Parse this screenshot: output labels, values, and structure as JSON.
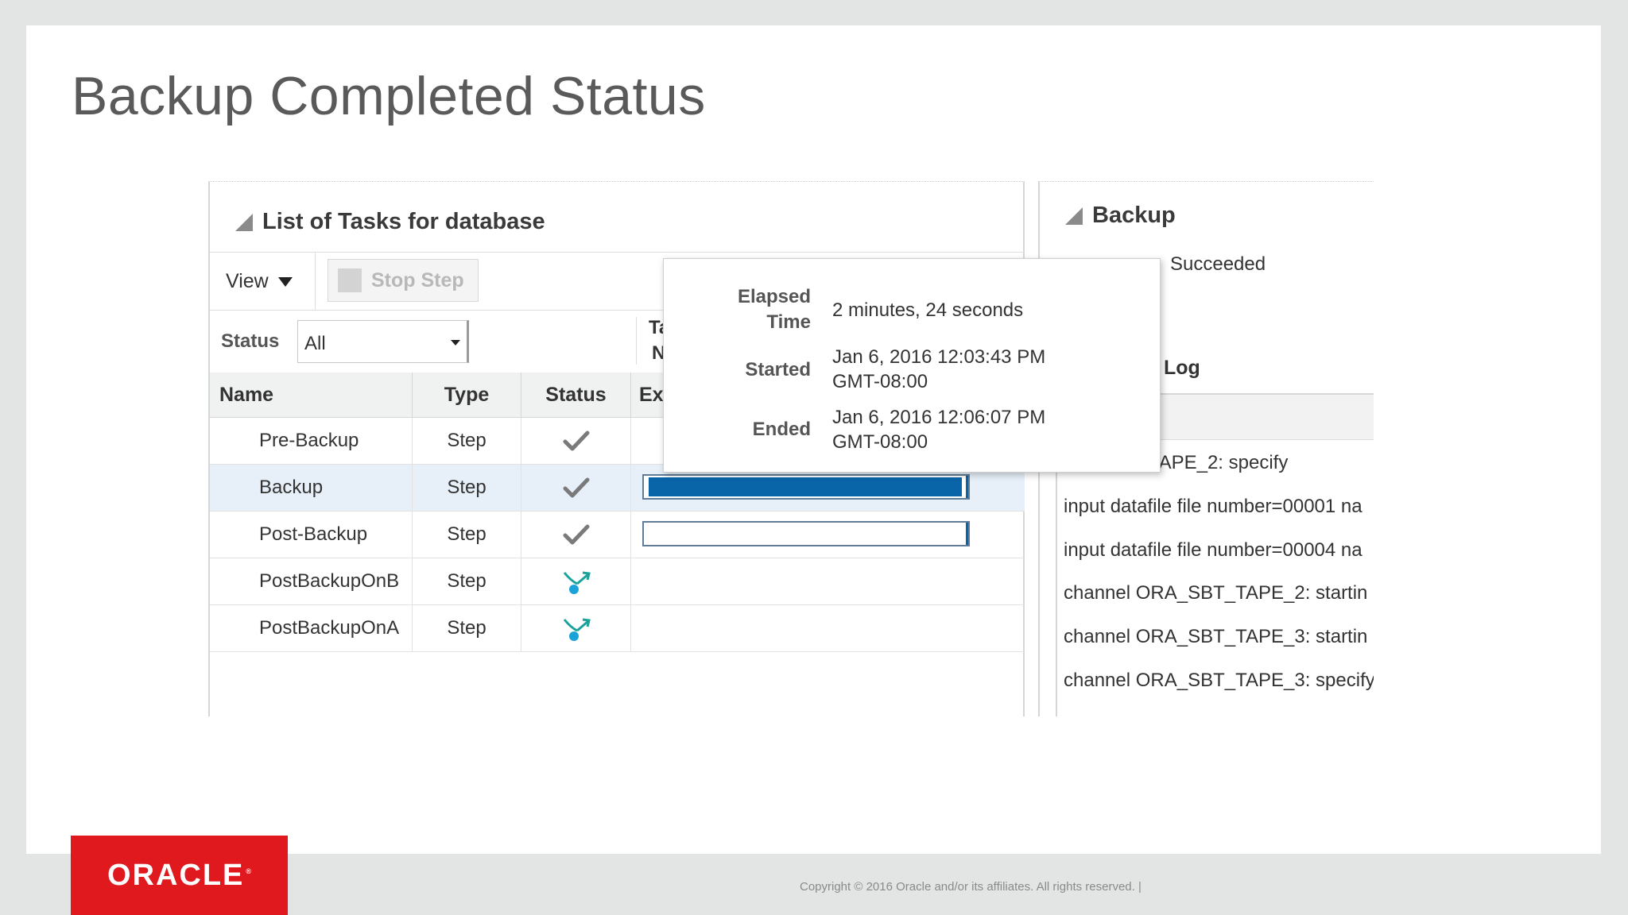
{
  "slide": {
    "title": "Backup Completed Status",
    "logo": "ORACLE",
    "copyright": "Copyright © 2016 Oracle and/or its affiliates. All rights reserved.  |"
  },
  "tasks": {
    "title": "List of Tasks for database",
    "view_label": "View",
    "stop_step_label": "Stop Step",
    "filter_label": "Status",
    "filter_value": "All",
    "trunc_col_line1": "Ta",
    "trunc_col_line2": "N",
    "columns": {
      "name": "Name",
      "type": "Type",
      "status": "Status",
      "exec": "Ex"
    },
    "rows": [
      {
        "name": "Pre-Backup",
        "type": "Step",
        "status": "check-icon"
      },
      {
        "name": "Backup",
        "type": "Step",
        "status": "check-icon",
        "progress": 1.0
      },
      {
        "name": "Post-Backup",
        "type": "Step",
        "status": "check-icon",
        "progress": 0.0
      },
      {
        "name": "PostBackupOnB",
        "type": "Step",
        "status": "skipped-icon"
      },
      {
        "name": "PostBackupOnA",
        "type": "Step",
        "status": "skipped-icon"
      }
    ]
  },
  "tooltip": {
    "elapsed_label_1": "Elapsed",
    "elapsed_label_2": "Time",
    "elapsed_value": "2 minutes, 24 seconds",
    "started_label": "Started",
    "started_value_1": "Jan 6, 2016 12:03:43 PM",
    "started_value_2": "GMT-08:00",
    "ended_label": "Ended",
    "ended_value_1": "Jan 6, 2016 12:06:07 PM",
    "ended_value_2": "GMT-08:00"
  },
  "backup": {
    "title": "Backup",
    "status": "Succeeded",
    "log_label": "Log",
    "log_lines": [
      "RA_SBT_TAPE_2: specify",
      "input datafile file number=00001 na",
      "input datafile file number=00004 na",
      "channel ORA_SBT_TAPE_2: startin",
      "channel ORA_SBT_TAPE_3: startin",
      "channel ORA_SBT_TAPE_3: specify"
    ]
  },
  "colors": {
    "accent_blue": "#0a64a8",
    "oracle_red": "#e0191e",
    "check_gray": "#7a7a7a",
    "skip_teal": "#1aa39a"
  }
}
